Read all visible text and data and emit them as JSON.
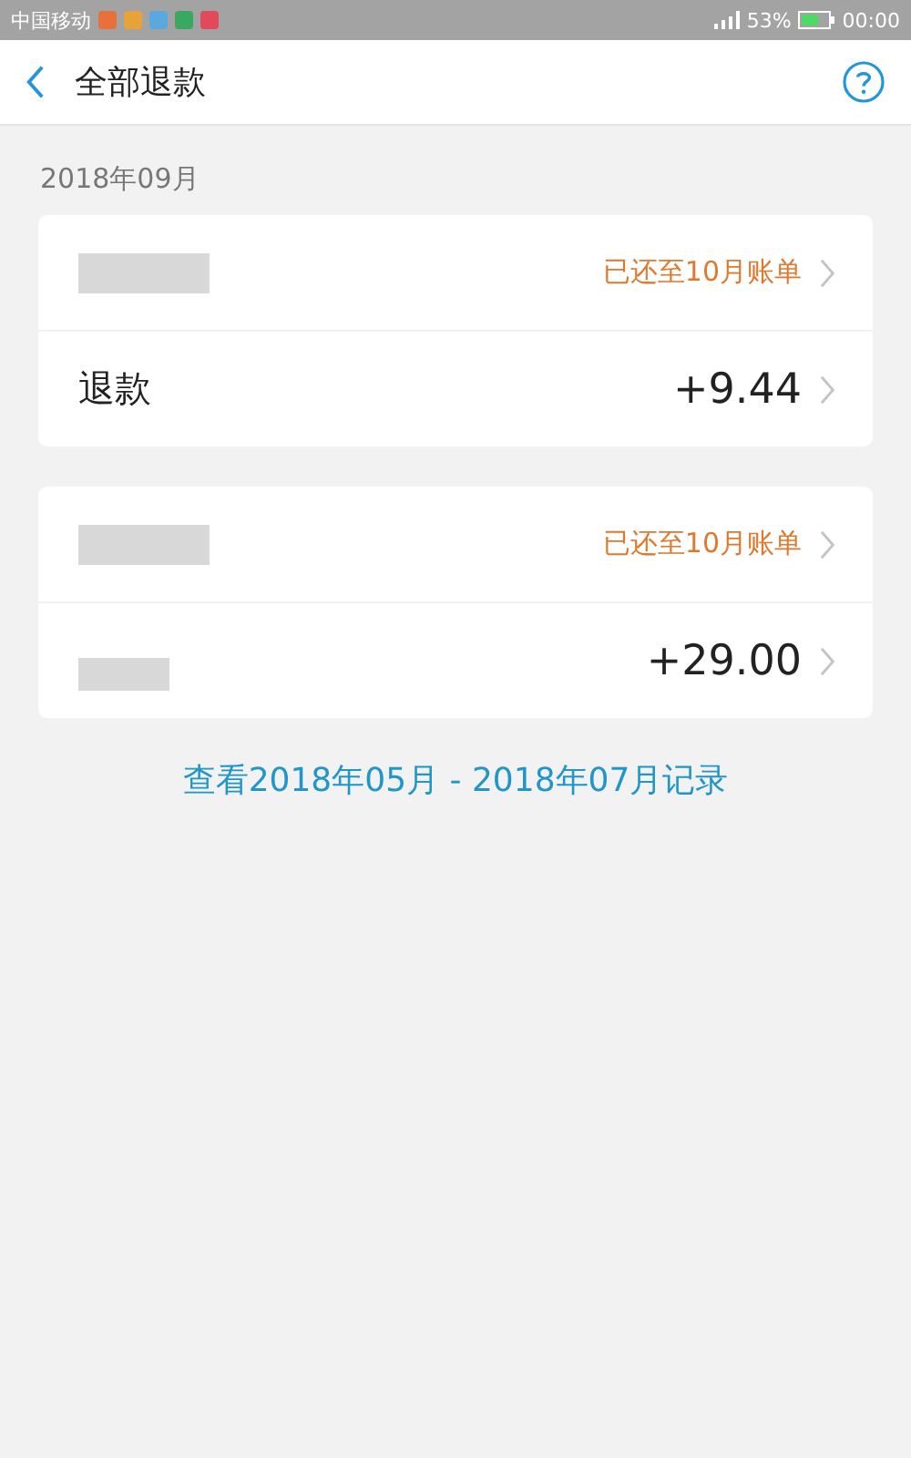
{
  "status_bar": {
    "carrier": "中国移动",
    "battery": "53%",
    "time": "00:00"
  },
  "header": {
    "title": "全部退款"
  },
  "month": "2018年09月",
  "records": [
    {
      "name_redacted": true,
      "status": "已还至10月账单",
      "label": "退款",
      "label_redacted": false,
      "amount": "+9.44"
    },
    {
      "name_redacted": true,
      "status": "已还至10月账单",
      "label_redacted": true,
      "amount": "+29.00"
    }
  ],
  "more_link": "查看2018年05月 - 2018年07月记录"
}
